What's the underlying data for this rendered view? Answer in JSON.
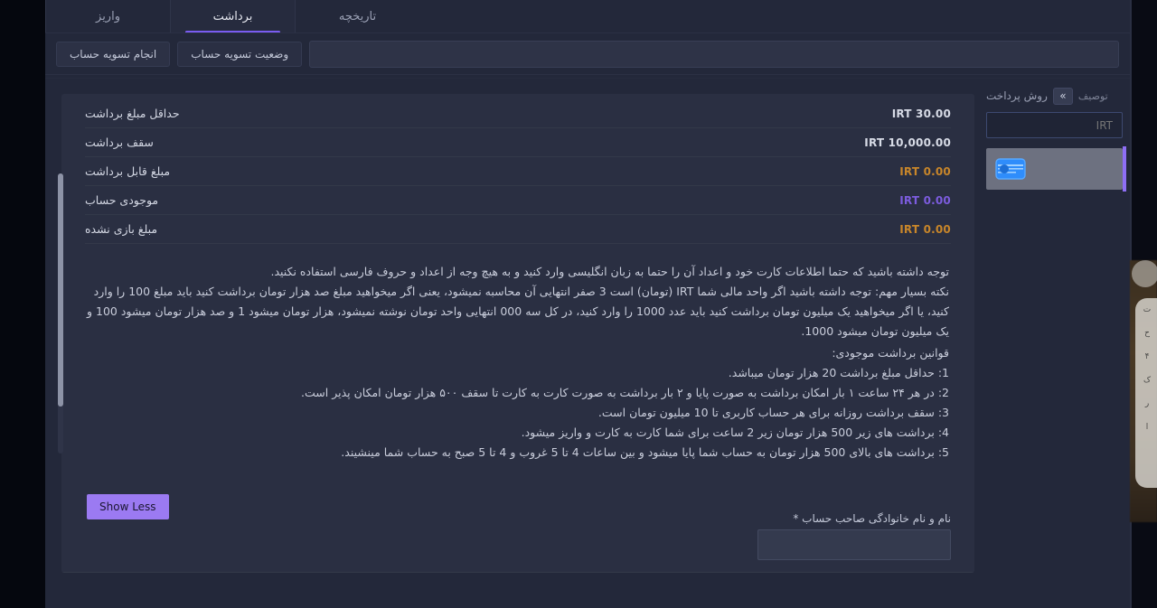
{
  "tabs": [
    {
      "label": "واریز",
      "active": false,
      "name": "tab-deposit"
    },
    {
      "label": "برداشت",
      "active": true,
      "name": "tab-withdraw"
    },
    {
      "label": "تاریخچه",
      "active": false,
      "name": "tab-history"
    }
  ],
  "actionbar": {
    "primary_label": "انجام تسویه حساب",
    "secondary_label": "وضعیت تسویه حساب",
    "search_value": "",
    "search_placeholder": ""
  },
  "payment_method": {
    "title": "روش پرداخت",
    "description_label": "توصیف",
    "expand_icon": "»",
    "currency_value": "",
    "currency_placeholder": "IRT",
    "card_icon": "bank-card-icon",
    "accent_color": "#8e6ff5"
  },
  "info_rows": [
    {
      "label": "حداقل مبلغ برداشت",
      "value": "IRT 30.00",
      "color": "#d7dbe6"
    },
    {
      "label": "سقف برداشت",
      "value": "IRT 10,000.00",
      "color": "#d7dbe6"
    },
    {
      "label": "مبلغ قابل برداشت",
      "value": "IRT 0.00",
      "color": "#c8862a"
    },
    {
      "label": "موجودی حساب",
      "value": "IRT 0.00",
      "color": "#7c5cde"
    },
    {
      "label": "مبلغ بازی نشده",
      "value": "IRT 0.00",
      "color": "#c8862a"
    }
  ],
  "notice": {
    "line1": "توجه داشته باشید که حتما اطلاعات کارت خود و اعداد آن را حتما به زبان انگلیسی وارد کنید و به هیچ وجه از اعداد و حروف فارسی استفاده نکنید.",
    "line2": "نکته بسیار مهم: توجه داشته باشید اگر واحد مالی شما IRT (تومان) است 3 صفر انتهایی آن محاسبه نمیشود، یعنی اگر میخواهید مبلغ صد هزار تومان برداشت کنید باید مبلغ 100 را وارد کنید، یا اگر میخواهید یک میلیون تومان برداشت کنید باید عدد 1000 را وارد کنید، در کل سه 000 انتهایی واحد تومان نوشته نمیشود، هزار تومان میشود 1 و صد هزار تومان میشود 100 و یک  میلیون تومان میشود 1000.",
    "rules_title": "قوانین برداشت موجودی:",
    "rules": [
      "1: حداقل مبلغ برداشت 20 هزار تومان میباشد.",
      "2: در هر ۲۴ ساعت ۱ بار امکان برداشت به صورت پایا و ۲ بار برداشت به صورت کارت به کارت تا سقف ۵۰۰ هزار تومان امکان پذیر است.",
      "3: سقف برداشت روزانه برای هر حساب کاربری تا 10 میلیون تومان است.",
      "4: برداشت های زیر 500 هزار تومان زیر 2 ساعت برای شما کارت به کارت و واریز میشود.",
      "5: برداشت های بالای 500 هزار تومان به حساب شما پایا میشود و بین ساعات 4 تا 5 غروب و 4 تا 5 صبح به حساب شما مینشیند."
    ]
  },
  "footer": {
    "show_less_label": "Show Less",
    "name_label": "نام و نام خانوادگی صاحب حساب *",
    "name_value": "",
    "name_placeholder": ""
  },
  "side_panel": {
    "chars": [
      "ت",
      "ح",
      "۴",
      "ک",
      "ر",
      "ا"
    ]
  }
}
